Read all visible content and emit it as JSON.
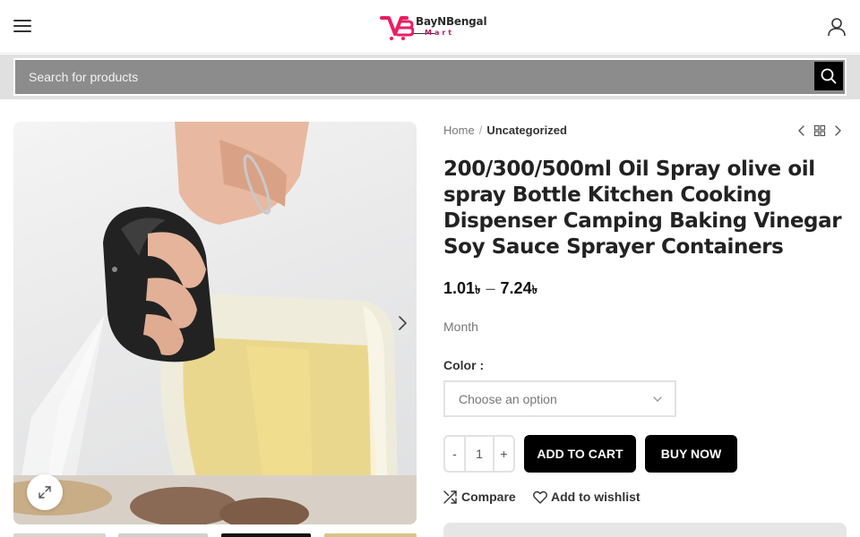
{
  "header": {
    "logo_text": "BayNBengal",
    "logo_subtext": "Mart",
    "brand_color": "#e91e63",
    "menu_icon": "hamburger-icon",
    "user_icon": "user-icon"
  },
  "search": {
    "placeholder": "Search for products",
    "button_icon": "search-icon"
  },
  "breadcrumb": {
    "home": "Home",
    "separator": "/",
    "current": "Uncategorized"
  },
  "product": {
    "title": "200/300/500ml Oil Spray olive oil spray Bottle Kitchen Cooking Dispenser Camping Baking Vinegar Soy Sauce Sprayer Containers",
    "price_min": "1.01",
    "price_max": "7.24",
    "price_separator": "–",
    "currency_symbol": "৳",
    "billing_period": "Month",
    "color_label": "Color",
    "color_label_suffix": " :",
    "color_placeholder": "Choose an option",
    "quantity": "1",
    "qty_minus": "-",
    "qty_plus": "+",
    "add_to_cart": "ADD TO CART",
    "buy_now": "BUY NOW",
    "compare": "Compare",
    "wishlist": "Add to wishlist"
  }
}
